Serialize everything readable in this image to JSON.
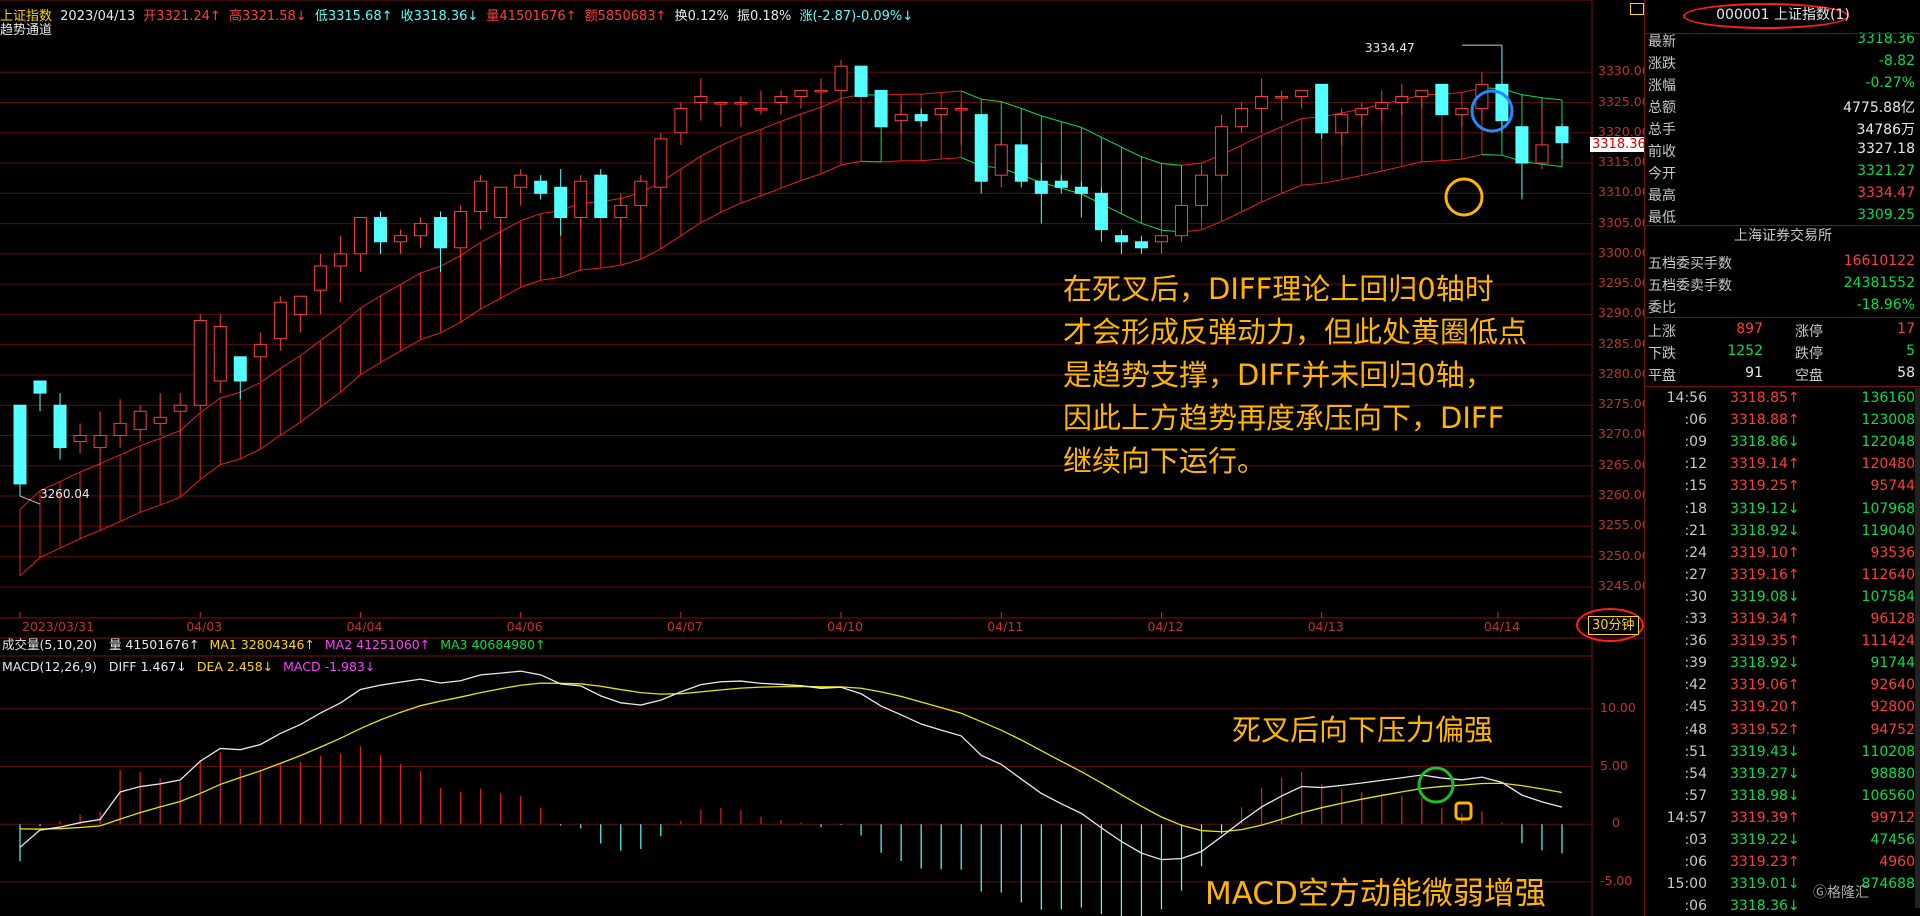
{
  "header": {
    "index_name": "上证指数",
    "date": "2023/04/13",
    "open": "开3321.24↑",
    "high": "高3321.58↓",
    "low": "低3315.68↑",
    "close": "收3318.36↓",
    "volume": "量41501676↑",
    "amount": "额5850683↑",
    "turnover": "换0.12%",
    "amplitude": "振0.18%",
    "change": "涨(-2.87)-0.09%↓",
    "indicator": "趋势通道"
  },
  "colors": {
    "up": "#ff3c3c",
    "down": "#54ffff",
    "channel_green": "#00e050",
    "dif": "#e8e8e8",
    "dea": "#e6e600",
    "annotation": "#ffb400",
    "panel_border": "#7a1010"
  },
  "price_axis": {
    "ticks": [
      "3330.00",
      "3325.00",
      "3320.00",
      "3315.00",
      "3310.00",
      "3305.00",
      "3300.00",
      "3295.00",
      "3290.00",
      "3285.00",
      "3280.00",
      "3275.00",
      "3270.00",
      "3265.00",
      "3260.00",
      "3255.00",
      "3250.00",
      "3245.00"
    ],
    "current_price_tag": "3318.36",
    "high_label": "3334.47",
    "low_label": "3260.04"
  },
  "date_axis": [
    "2023/03/31",
    "04/03",
    "04/04",
    "04/06",
    "04/07",
    "04/10",
    "04/11",
    "04/12",
    "04/13",
    "04/14"
  ],
  "period_button": "30分钟",
  "volume_line": {
    "name": "成交量(5,10,20)",
    "vol": "量 41501676↑",
    "ma1": "MA1 32804346↑",
    "ma2": "MA2 41251060↑",
    "ma3": "MA3 40684980↑"
  },
  "macd_line": {
    "name": "MACD(12,26,9)",
    "diff": "DIFF 1.467↓",
    "dea": "DEA 2.458↓",
    "macd": "MACD -1.983↓"
  },
  "macd_axis": [
    "10.00",
    "5.00",
    "0",
    "-5.00"
  ],
  "annotations": {
    "main": [
      "在死叉后，DIFF理论上回归0轴时",
      "才会形成反弹动力，但此处黄圈低点",
      "是趋势支撑，DIFF并未回归0轴，",
      "因此上方趋势再度承压向下，DIFF",
      "继续向下运行。"
    ],
    "pressure": "死叉后向下压力偏强",
    "macd_note": "MACD空方动能微弱增强"
  },
  "quote_panel": {
    "title": "000001 上证指数(1)",
    "rows": [
      {
        "label": "最新",
        "value": "3318.36",
        "color": "green"
      },
      {
        "label": "涨跌",
        "value": "-8.82",
        "color": "green"
      },
      {
        "label": "涨幅",
        "value": "-0.27%",
        "color": "green"
      },
      {
        "label": "总额",
        "value": "4775.88亿",
        "color": "white"
      },
      {
        "label": "总手",
        "value": "34786万",
        "color": "white"
      },
      {
        "label": "前收",
        "value": "3327.18",
        "color": "white"
      },
      {
        "label": "今开",
        "value": "3321.27",
        "color": "green"
      },
      {
        "label": "最高",
        "value": "3334.47",
        "color": "red"
      },
      {
        "label": "最低",
        "value": "3309.25",
        "color": "green"
      }
    ],
    "exchange": "上海证券交易所",
    "rows2": [
      {
        "label": "五档委买手数",
        "value": "16610122",
        "color": "red"
      },
      {
        "label": "五档委卖手数",
        "value": "24381552",
        "color": "green"
      },
      {
        "label": "委比",
        "value": "-18.96%",
        "color": "green"
      }
    ],
    "breadth": [
      {
        "l1": "上涨",
        "v1": "897",
        "l2": "涨停",
        "v2": "17",
        "c1": "red",
        "c2": "red"
      },
      {
        "l1": "下跌",
        "v1": "1252",
        "l2": "跌停",
        "v2": "5",
        "c1": "green",
        "c2": "green"
      },
      {
        "l1": "平盘",
        "v1": "91",
        "l2": "空盘",
        "v2": "58",
        "c1": "white",
        "c2": "white"
      }
    ],
    "ticks": [
      {
        "t": "14:56",
        "p": "3318.85↑",
        "v": "136160",
        "pc": "red",
        "vc": "green"
      },
      {
        "t": ":06",
        "p": "3318.88↑",
        "v": "123008",
        "pc": "red",
        "vc": "green"
      },
      {
        "t": ":09",
        "p": "3318.86↓",
        "v": "122048",
        "pc": "green",
        "vc": "green"
      },
      {
        "t": ":12",
        "p": "3319.14↑",
        "v": "120480",
        "pc": "red",
        "vc": "red"
      },
      {
        "t": ":15",
        "p": "3319.25↑",
        "v": "95744",
        "pc": "red",
        "vc": "red"
      },
      {
        "t": ":18",
        "p": "3319.12↓",
        "v": "107968",
        "pc": "green",
        "vc": "green"
      },
      {
        "t": ":21",
        "p": "3318.92↓",
        "v": "119040",
        "pc": "green",
        "vc": "green"
      },
      {
        "t": ":24",
        "p": "3319.10↑",
        "v": "93536",
        "pc": "red",
        "vc": "red"
      },
      {
        "t": ":27",
        "p": "3319.16↑",
        "v": "112640",
        "pc": "red",
        "vc": "red"
      },
      {
        "t": ":30",
        "p": "3319.08↓",
        "v": "107584",
        "pc": "green",
        "vc": "green"
      },
      {
        "t": ":33",
        "p": "3319.34↑",
        "v": "96128",
        "pc": "red",
        "vc": "red"
      },
      {
        "t": ":36",
        "p": "3319.35↑",
        "v": "111424",
        "pc": "red",
        "vc": "red"
      },
      {
        "t": ":39",
        "p": "3318.92↓",
        "v": "91744",
        "pc": "green",
        "vc": "green"
      },
      {
        "t": ":42",
        "p": "3319.06↑",
        "v": "92640",
        "pc": "red",
        "vc": "red"
      },
      {
        "t": ":45",
        "p": "3319.20↑",
        "v": "92800",
        "pc": "red",
        "vc": "red"
      },
      {
        "t": ":48",
        "p": "3319.52↑",
        "v": "94752",
        "pc": "red",
        "vc": "red"
      },
      {
        "t": ":51",
        "p": "3319.43↓",
        "v": "110208",
        "pc": "green",
        "vc": "green"
      },
      {
        "t": ":54",
        "p": "3319.27↓",
        "v": "98880",
        "pc": "green",
        "vc": "green"
      },
      {
        "t": ":57",
        "p": "3318.98↓",
        "v": "106560",
        "pc": "green",
        "vc": "green"
      },
      {
        "t": "14:57",
        "p": "3319.39↑",
        "v": "99712",
        "pc": "red",
        "vc": "red"
      },
      {
        "t": ":03",
        "p": "3319.22↓",
        "v": "47456",
        "pc": "green",
        "vc": "green"
      },
      {
        "t": ":06",
        "p": "3319.23↑",
        "v": "4960",
        "pc": "red",
        "vc": "red"
      },
      {
        "t": "15:00",
        "p": "3319.01↓",
        "v": "874688",
        "pc": "green",
        "vc": "green"
      },
      {
        "t": ":06",
        "p": "3318.36↓",
        "v": "",
        "pc": "green",
        "vc": "green"
      }
    ],
    "watermark": "格隆汇"
  },
  "chart_data": {
    "type": "candlestick",
    "period": "30分钟",
    "candles": [
      [
        3275,
        3274,
        3260,
        3262
      ],
      [
        3279,
        3279,
        3274,
        3277
      ],
      [
        3275,
        3277,
        3266,
        3268
      ],
      [
        3269,
        3272,
        3267,
        3270
      ],
      [
        3268,
        3274,
        3265,
        3270
      ],
      [
        3270,
        3276,
        3268,
        3272
      ],
      [
        3271,
        3275,
        3269,
        3274
      ],
      [
        3272,
        3277,
        3270,
        3273
      ],
      [
        3274,
        3277,
        3270,
        3275
      ],
      [
        3275,
        3290,
        3274,
        3289
      ],
      [
        3279,
        3290,
        3277,
        3288
      ],
      [
        3283,
        3283,
        3276,
        3279
      ],
      [
        3283,
        3287,
        3279,
        3285
      ],
      [
        3286,
        3293,
        3284,
        3292
      ],
      [
        3290,
        3293,
        3287,
        3293
      ],
      [
        3294,
        3300,
        3290,
        3298
      ],
      [
        3298,
        3303,
        3292,
        3300
      ],
      [
        3300,
        3306,
        3297,
        3306
      ],
      [
        3306,
        3307,
        3300,
        3302
      ],
      [
        3302,
        3304,
        3300,
        3303
      ],
      [
        3303,
        3306,
        3301,
        3305
      ],
      [
        3306,
        3307,
        3297,
        3301
      ],
      [
        3301,
        3308,
        3299,
        3307
      ],
      [
        3307,
        3313,
        3304,
        3312
      ],
      [
        3306,
        3311,
        3298,
        3311
      ],
      [
        3311,
        3314,
        3308,
        3313
      ],
      [
        3312,
        3313,
        3309,
        3310
      ],
      [
        3311,
        3314,
        3303,
        3306
      ],
      [
        3306,
        3313,
        3304,
        3312
      ],
      [
        3313,
        3314,
        3306,
        3306
      ],
      [
        3306,
        3310,
        3304,
        3308
      ],
      [
        3308,
        3313,
        3305,
        3312
      ],
      [
        3311,
        3320,
        3309,
        3319
      ],
      [
        3320,
        3325,
        3318,
        3324
      ],
      [
        3325,
        3329,
        3322,
        3326
      ],
      [
        3325,
        3325,
        3321,
        3325
      ],
      [
        3325,
        3326,
        3321,
        3325
      ],
      [
        3324,
        3327,
        3323,
        3324
      ],
      [
        3325,
        3327,
        3323,
        3326
      ],
      [
        3326,
        3327,
        3324,
        3327
      ],
      [
        3327,
        3329,
        3320,
        3327
      ],
      [
        3327,
        3332,
        3324,
        3331
      ],
      [
        3331,
        3331,
        3326,
        3326
      ],
      [
        3327,
        3327,
        3321,
        3321
      ],
      [
        3322,
        3325,
        3320,
        3323
      ],
      [
        3323,
        3324,
        3321,
        3322
      ],
      [
        3323,
        3324,
        3320,
        3324
      ],
      [
        3324,
        3325,
        3318,
        3324
      ],
      [
        3323,
        3323,
        3310,
        3312
      ],
      [
        3313,
        3319,
        3311,
        3318
      ],
      [
        3318,
        3318,
        3311,
        3312
      ],
      [
        3312,
        3315,
        3305,
        3310
      ],
      [
        3312,
        3313,
        3310,
        3311
      ],
      [
        3311,
        3312,
        3306,
        3310
      ],
      [
        3310,
        3311,
        3302,
        3304
      ],
      [
        3303,
        3304,
        3300,
        3302
      ],
      [
        3302,
        3303,
        3300,
        3301
      ],
      [
        3302,
        3306,
        3300,
        3303
      ],
      [
        3303,
        3309,
        3302,
        3308
      ],
      [
        3308,
        3314,
        3306,
        3313
      ],
      [
        3313,
        3323,
        3312,
        3321
      ],
      [
        3321,
        3325,
        3320,
        3324
      ],
      [
        3324,
        3329,
        3320,
        3326
      ],
      [
        3326,
        3327,
        3322,
        3326
      ],
      [
        3326,
        3327,
        3324,
        3327
      ],
      [
        3328,
        3328,
        3319,
        3320
      ],
      [
        3320,
        3324,
        3318,
        3323
      ],
      [
        3323,
        3325,
        3321,
        3324
      ],
      [
        3324,
        3327,
        3322,
        3325
      ],
      [
        3325,
        3328,
        3323,
        3326
      ],
      [
        3326,
        3327,
        3324,
        3327
      ],
      [
        3328,
        3328,
        3323,
        3323
      ],
      [
        3323,
        3324,
        3321,
        3324
      ],
      [
        3324,
        3330,
        3322,
        3328
      ],
      [
        3328,
        3334.47,
        3320,
        3322
      ],
      [
        3321,
        3321,
        3309,
        3315
      ],
      [
        3315,
        3324,
        3314,
        3318
      ],
      [
        3321,
        3321.58,
        3315.68,
        3318.36
      ]
    ],
    "channel_upper_start": 3257,
    "channel_lower_start": 3244,
    "price_range": [
      3242,
      3334.5
    ],
    "macd_range": [
      -7,
      12.5
    ]
  }
}
